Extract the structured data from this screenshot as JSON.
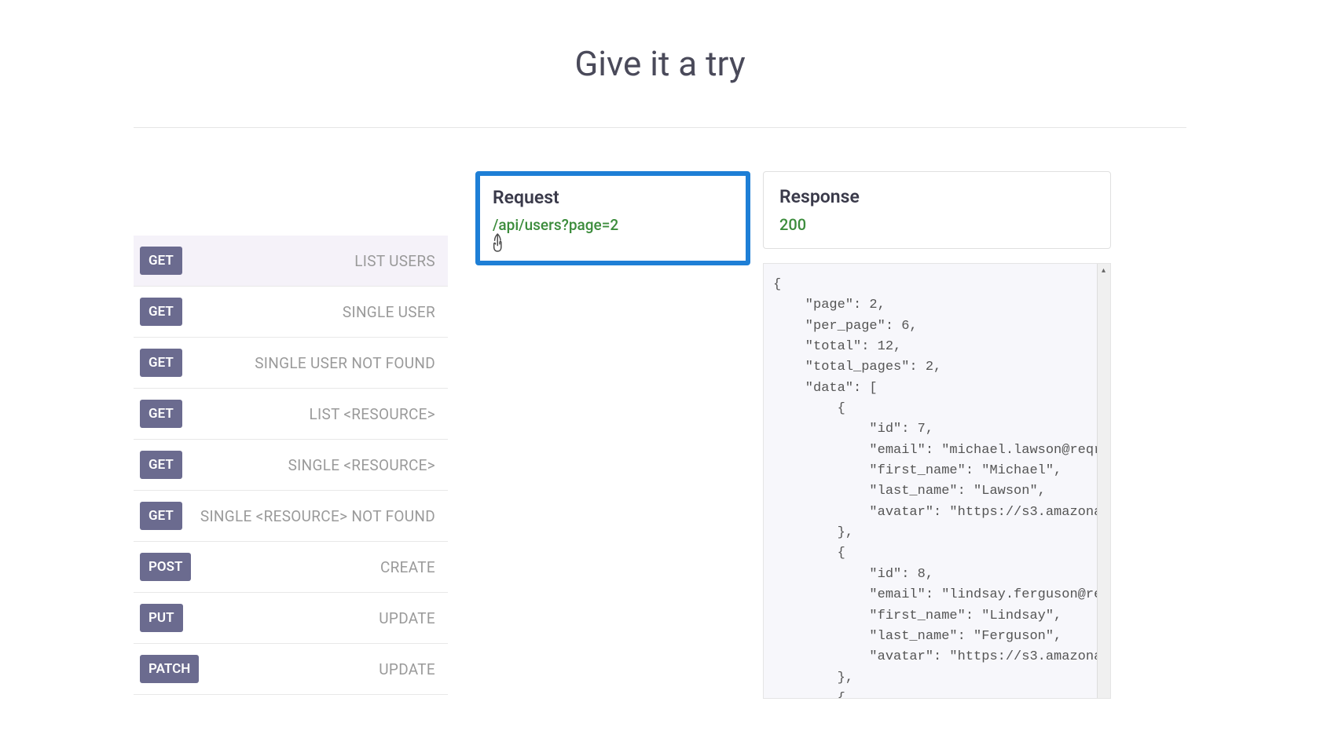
{
  "title": "Give it a try",
  "endpoints": [
    {
      "method": "GET",
      "label": "LIST USERS",
      "active": true
    },
    {
      "method": "GET",
      "label": "SINGLE USER",
      "active": false
    },
    {
      "method": "GET",
      "label": "SINGLE USER NOT FOUND",
      "active": false
    },
    {
      "method": "GET",
      "label": "LIST <RESOURCE>",
      "active": false
    },
    {
      "method": "GET",
      "label": "SINGLE <RESOURCE>",
      "active": false
    },
    {
      "method": "GET",
      "label": "SINGLE <RESOURCE> NOT FOUND",
      "active": false
    },
    {
      "method": "POST",
      "label": "CREATE",
      "active": false
    },
    {
      "method": "PUT",
      "label": "UPDATE",
      "active": false
    },
    {
      "method": "PATCH",
      "label": "UPDATE",
      "active": false
    }
  ],
  "request": {
    "header": "Request",
    "url": "/api/users?page=2"
  },
  "response": {
    "header": "Response",
    "status": "200",
    "body": "{\n    \"page\": 2,\n    \"per_page\": 6,\n    \"total\": 12,\n    \"total_pages\": 2,\n    \"data\": [\n        {\n            \"id\": 7,\n            \"email\": \"michael.lawson@reqres.\n            \"first_name\": \"Michael\",\n            \"last_name\": \"Lawson\",\n            \"avatar\": \"https://s3.amazonaws.\n        },\n        {\n            \"id\": 8,\n            \"email\": \"lindsay.ferguson@reqre\n            \"first_name\": \"Lindsay\",\n            \"last_name\": \"Ferguson\",\n            \"avatar\": \"https://s3.amazonaws.\n        },\n        {"
  }
}
